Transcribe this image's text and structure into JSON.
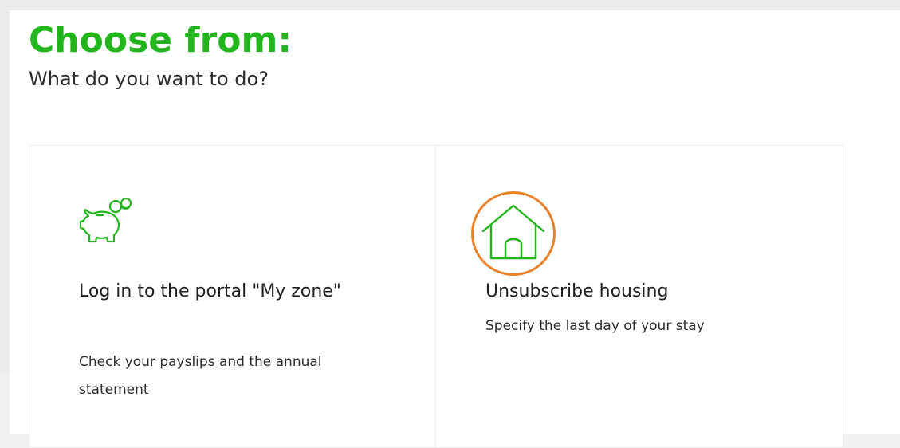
{
  "header": {
    "title": "Choose from:",
    "subtitle": "What do you want to do?"
  },
  "cards": [
    {
      "title": "Log in to the portal \"My zone\"",
      "description": "Check your payslips and the annual statement",
      "icon": "piggy-bank-icon"
    },
    {
      "title": "Unsubscribe housing",
      "description": "Specify the last day of your stay",
      "icon": "house-icon"
    }
  ],
  "colors": {
    "brand_green": "#22b51d",
    "highlight_orange": "#e8822a",
    "text": "#1f1f1f"
  }
}
